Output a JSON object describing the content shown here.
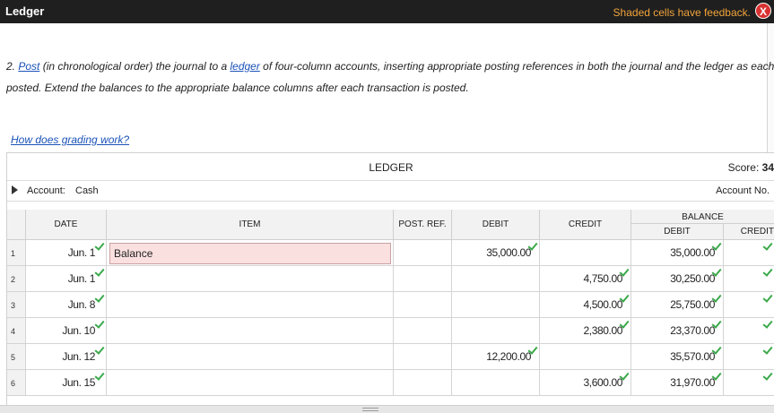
{
  "window": {
    "title": "Ledger",
    "feedback_text": "Shaded cells have feedback.",
    "close_glyph": "X"
  },
  "instructions": {
    "line1": {
      "prefix": "2. ",
      "link1": "Post",
      "mid1": " (in chronological order) the journal to a ",
      "link2": "ledger",
      "rest": " of four-column accounts, inserting appropriate posting references in both the journal and the ledger as each"
    },
    "line2": "posted. Extend the balances to the appropriate balance columns after each transaction is posted.",
    "grading_link": "How does grading work?"
  },
  "ledger": {
    "title": "LEDGER",
    "score_label": "Score:",
    "score_value": "34",
    "account_label": "Account:",
    "account_name": "Cash",
    "account_no_label": "Account No.",
    "headers": {
      "date": "DATE",
      "item": "ITEM",
      "post_ref": "POST. REF.",
      "debit": "DEBIT",
      "credit": "CREDIT",
      "balance": "BALANCE",
      "balance_debit": "DEBIT",
      "balance_credit": "CREDIT"
    },
    "rows": [
      {
        "num": "1",
        "date": "Jun. 1",
        "item": "Balance",
        "post_ref": "",
        "debit": "35,000.00",
        "credit": "",
        "bal_debit": "35,000.00",
        "bal_credit": ""
      },
      {
        "num": "2",
        "date": "Jun. 1",
        "item": "",
        "post_ref": "",
        "debit": "",
        "credit": "4,750.00",
        "bal_debit": "30,250.00",
        "bal_credit": ""
      },
      {
        "num": "3",
        "date": "Jun. 8",
        "item": "",
        "post_ref": "",
        "debit": "",
        "credit": "4,500.00",
        "bal_debit": "25,750.00",
        "bal_credit": ""
      },
      {
        "num": "4",
        "date": "Jun. 10",
        "item": "",
        "post_ref": "",
        "debit": "",
        "credit": "2,380.00",
        "bal_debit": "23,370.00",
        "bal_credit": ""
      },
      {
        "num": "5",
        "date": "Jun. 12",
        "item": "",
        "post_ref": "",
        "debit": "12,200.00",
        "credit": "",
        "bal_debit": "35,570.00",
        "bal_credit": ""
      },
      {
        "num": "6",
        "date": "Jun. 15",
        "item": "",
        "post_ref": "",
        "debit": "",
        "credit": "3,600.00",
        "bal_debit": "31,970.00",
        "bal_credit": ""
      }
    ]
  },
  "colors": {
    "titlebar_bg": "#1f1f1f",
    "feedback_orange": "#f3a43a",
    "check_green": "#3aa94a",
    "error_fill": "#fbe0e0",
    "link_blue": "#1a52b8"
  },
  "icons": {
    "close": "close-icon",
    "expand": "triangle-right-icon",
    "check": "checkmark-icon"
  }
}
